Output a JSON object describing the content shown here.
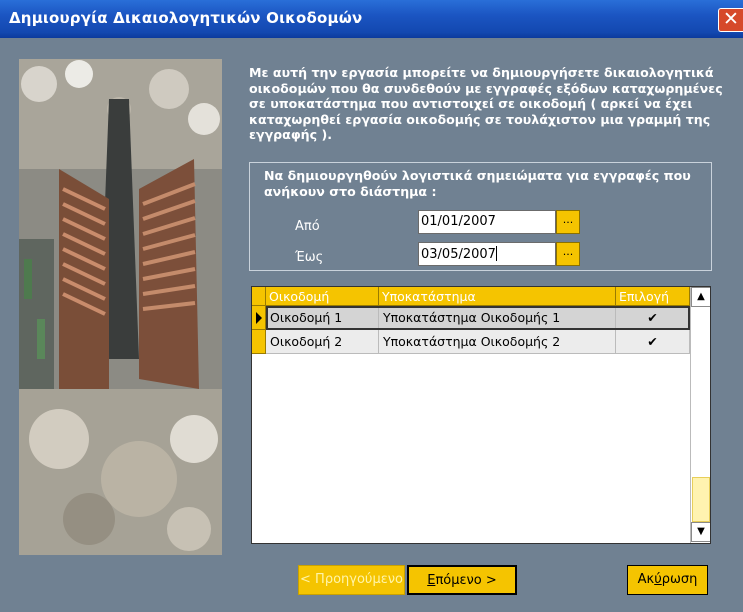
{
  "window": {
    "title": "Δημιουργία Δικαιολογητικών Οικοδομών",
    "close_glyph": "✕"
  },
  "intro_text": "Με αυτή την εργασία μπορείτε να δημιουργήσετε δικαιολογητικά οικοδομών που θα συνδεθούν με εγγραφές εξόδων καταχωρημένες σε υποκατάστημα που αντιστοιχεί σε οικοδομή ( αρκεί να έχει καταχωρηθεί εργασία οικοδομής σε τουλάχιστον μια γραμμή της εγγραφής ).",
  "date_range": {
    "title": "Να δημιουργηθούν λογιστικά σημειώματα για εγγραφές που ανήκουν στο διάστημα :",
    "from_label": "Από",
    "from_value": "01/01/2007",
    "to_label": "Έως",
    "to_value": "03/05/2007",
    "picker_label": "..."
  },
  "grid": {
    "columns": [
      "Οικοδομή",
      "Υποκατάστημα",
      "Επιλογή"
    ],
    "rows": [
      {
        "building": "Οικοδομή 1",
        "branch": "Υποκατάστημα Οικοδομής 1",
        "selected": "✔"
      },
      {
        "building": "Οικοδομή 2",
        "branch": "Υποκατάστημα Οικοδομής 2",
        "selected": "✔"
      }
    ],
    "scroll_up": "▲",
    "scroll_down": "▼"
  },
  "buttons": {
    "previous": "< Προηγούμενο",
    "next_prefix": "",
    "next_underlined": "Ε",
    "next_rest": "πόμενο >",
    "cancel_prefix": "Ακ",
    "cancel_underlined": "ύ",
    "cancel_rest": "ρωση"
  },
  "colors": {
    "titlebar": "#1b55c2",
    "panel_bg": "#708192",
    "accent_yellow": "#f5c400",
    "close_red": "#d6492a"
  }
}
